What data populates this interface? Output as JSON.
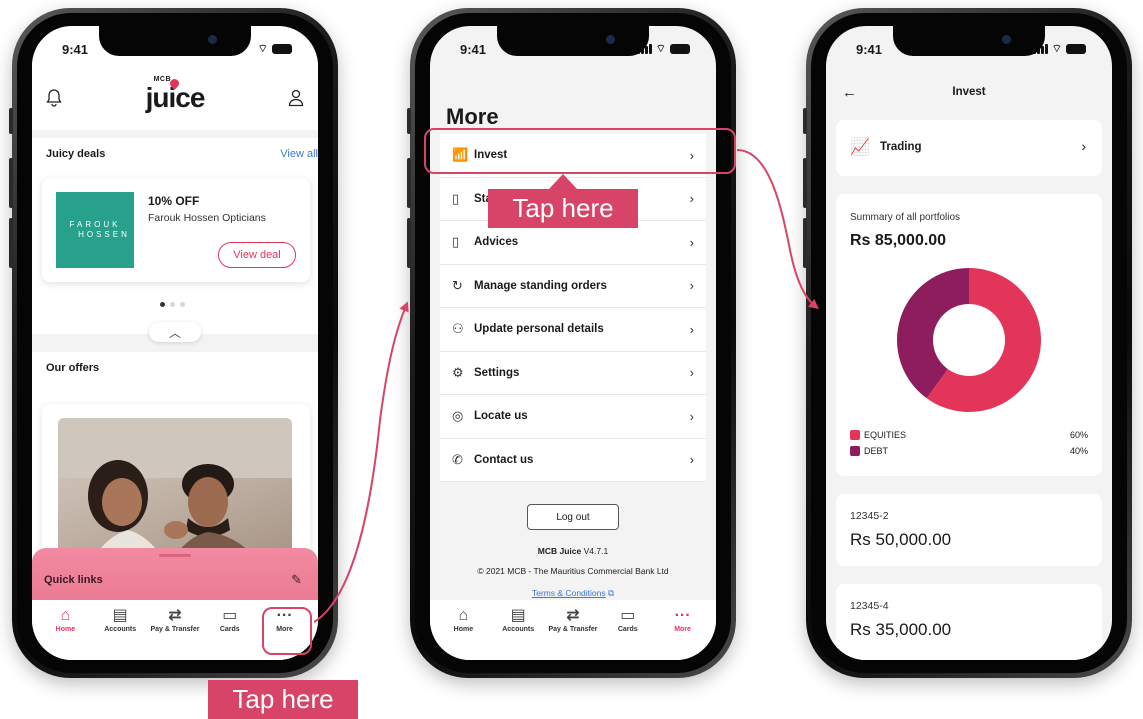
{
  "status_time": "9:41",
  "phone1": {
    "logo_mcb": "MCB",
    "logo_text": "juice",
    "juicy_deals": {
      "title": "Juicy deals",
      "view_all": "View all"
    },
    "deal": {
      "discount": "10% OFF",
      "merchant": "Farouk Hossen Opticians",
      "logo_line1": "FAROUK",
      "logo_line2": "HOSSEN",
      "cta": "View deal"
    },
    "offers_title": "Our offers",
    "quick_links": "Quick links"
  },
  "tabbar": [
    {
      "label": "Home",
      "icon": "home-icon"
    },
    {
      "label": "Accounts",
      "icon": "accounts-icon"
    },
    {
      "label": "Pay & Transfer",
      "icon": "transfer-icon"
    },
    {
      "label": "Cards",
      "icon": "card-icon"
    },
    {
      "label": "More",
      "icon": "more-icon"
    }
  ],
  "phone2": {
    "title": "More",
    "menu": [
      {
        "label": "Invest",
        "icon": "invest-icon"
      },
      {
        "label": "Statements",
        "icon": "statement-icon"
      },
      {
        "label": "Advices",
        "icon": "advice-icon"
      },
      {
        "label": "Manage standing orders",
        "icon": "standing-order-icon"
      },
      {
        "label": "Update personal details",
        "icon": "person-icon"
      },
      {
        "label": "Settings",
        "icon": "settings-icon"
      },
      {
        "label": "Locate us",
        "icon": "location-icon"
      },
      {
        "label": "Contact us",
        "icon": "phone-icon"
      }
    ],
    "logout": "Log out",
    "app_name": "MCB Juice",
    "version": "V4.7.1",
    "copyright": "© 2021 MCB - The Mauritius Commercial Bank Ltd",
    "terms": "Terms & Conditions"
  },
  "phone3": {
    "title": "Invest",
    "trading": "Trading",
    "summary_label": "Summary of all portfolios",
    "summary_value": "Rs 85,000.00",
    "portfolios": [
      {
        "id": "12345-2",
        "value": "Rs 50,000.00"
      },
      {
        "id": "12345-4",
        "value": "Rs 35,000.00"
      }
    ]
  },
  "chart_data": {
    "type": "pie",
    "categories": [
      "EQUITIES",
      "DEBT"
    ],
    "values": [
      60,
      40
    ],
    "labels": [
      "60%",
      "40%"
    ],
    "colors": [
      "#e3355a",
      "#8e1d5e"
    ],
    "legend": "bottom"
  },
  "annotations": {
    "tap_here": "Tap here"
  },
  "colors": {
    "accent": "#e3355a",
    "callout": "#d84468",
    "link": "#3a78d6"
  }
}
